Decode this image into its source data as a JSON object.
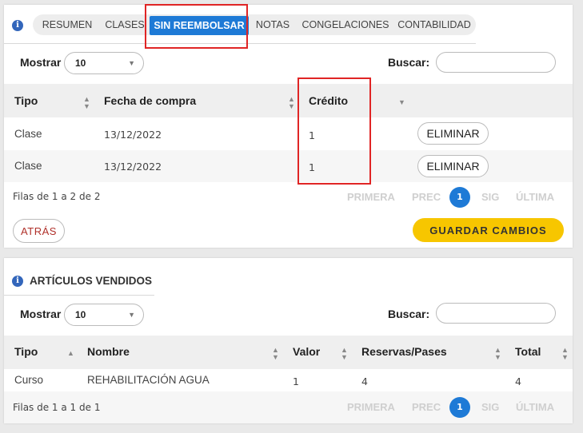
{
  "tabs": [
    {
      "label": "RESUMEN"
    },
    {
      "label": "CLASES"
    },
    {
      "label": "SIN REEMBOLSAR",
      "active": true
    },
    {
      "label": "NOTAS"
    },
    {
      "label": "CONGELACIONES"
    },
    {
      "label": "CONTABILIDAD"
    }
  ],
  "colors": {
    "accent": "#1e7ad6",
    "save": "#f7c600",
    "highlight": "#e02525",
    "back_text": "#b0302a"
  },
  "refunds": {
    "show_label": "Mostrar",
    "show_value": "10",
    "search_label": "Buscar:",
    "search_value": "",
    "columns": {
      "tipo": "Tipo",
      "fecha": "Fecha de compra",
      "credito": "Crédito"
    },
    "rows": [
      {
        "tipo": "Clase",
        "fecha": "13/12/2022",
        "credito": "1",
        "action": "ELIMINAR"
      },
      {
        "tipo": "Clase",
        "fecha": "13/12/2022",
        "credito": "1",
        "action": "ELIMINAR"
      }
    ],
    "footer": "Filas de 1 a 2 de 2",
    "pager": {
      "first": "PRIMERA",
      "prev": "PREC",
      "current": "1",
      "next": "SIG",
      "last": "ÚLTIMA"
    },
    "back_label": "ATRÁS",
    "save_label": "GUARDAR CAMBIOS"
  },
  "sold": {
    "title": "ARTÍCULOS VENDIDOS",
    "show_label": "Mostrar",
    "show_value": "10",
    "search_label": "Buscar:",
    "search_value": "",
    "columns": {
      "tipo": "Tipo",
      "nombre": "Nombre",
      "valor": "Valor",
      "reservas": "Reservas/Pases",
      "total": "Total"
    },
    "rows": [
      {
        "tipo": "Curso",
        "nombre": "REHABILITACIÓN AGUA",
        "valor": "1",
        "reservas": "4",
        "total": "4"
      }
    ],
    "footer": "Filas de 1 a 1 de 1",
    "pager": {
      "first": "PRIMERA",
      "prev": "PREC",
      "current": "1",
      "next": "SIG",
      "last": "ÚLTIMA"
    }
  }
}
